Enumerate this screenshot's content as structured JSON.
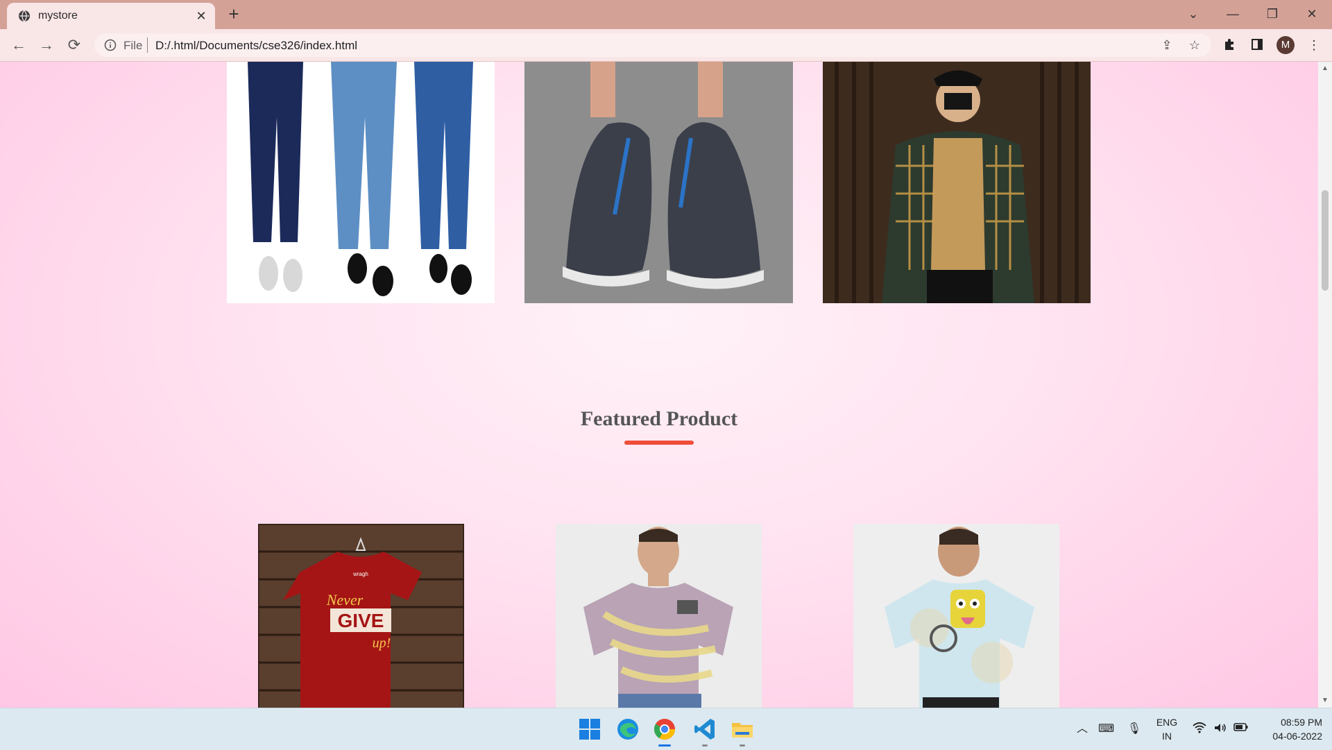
{
  "browser": {
    "tab_title": "mystore",
    "url_scheme": "File",
    "url": "D:/.html/Documents/cse326/index.html",
    "avatar_letter": "M"
  },
  "page": {
    "top_products": [
      {
        "image": "jeans-product-image"
      },
      {
        "image": "sneakers-product-image"
      },
      {
        "image": "plaid-shirt-product-image"
      }
    ],
    "featured_title": "Featured Product",
    "featured_products": [
      {
        "image": "red-tshirt-never-give-up-image",
        "print_line1": "Never",
        "print_line2": "GIVE",
        "print_line3": "up!",
        "brand": "wragh"
      },
      {
        "image": "tie-dye-tshirt-image"
      },
      {
        "image": "graphic-tshirt-back-image"
      }
    ],
    "accent_color": "#ef4d3a"
  },
  "taskbar": {
    "language": "ENG",
    "region": "IN",
    "time": "08:59 PM",
    "date": "04-06-2022"
  }
}
